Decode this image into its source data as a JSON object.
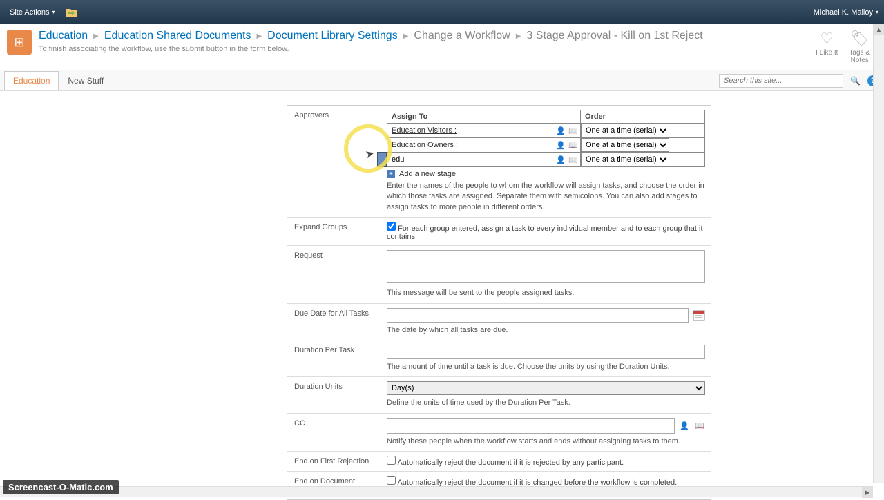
{
  "ribbon": {
    "site_actions": "Site Actions",
    "user": "Michael K. Malloy"
  },
  "breadcrumb": {
    "items": [
      "Education",
      "Education Shared Documents",
      "Document Library Settings",
      "Change a Workflow",
      "3 Stage Approval - Kill on 1st Reject"
    ],
    "subtitle": "To finish associating the workflow, use the submit button in the form below."
  },
  "header_actions": {
    "like": "I Like It",
    "tags": "Tags &\nNotes"
  },
  "tabs": {
    "active": "Education",
    "second": "New Stuff"
  },
  "search": {
    "placeholder": "Search this site..."
  },
  "form": {
    "approvers": {
      "label": "Approvers",
      "assign_header": "Assign To",
      "order_header": "Order",
      "rows": [
        {
          "value": "Education Visitors ;",
          "order": "One at a time (serial)"
        },
        {
          "value": "Education Owners ;",
          "order": "One at a time (serial)"
        },
        {
          "value": "edu",
          "order": "One at a time (serial)"
        }
      ],
      "add_stage": "Add a new stage",
      "help": "Enter the names of the people to whom the workflow will assign tasks, and choose the order in which those tasks are assigned. Separate them with semicolons. You can also add stages to assign tasks to more people in different orders."
    },
    "expand": {
      "label": "Expand Groups",
      "text": "For each group entered, assign a task to every individual member and to each group that it contains."
    },
    "request": {
      "label": "Request",
      "help": "This message will be sent to the people assigned tasks."
    },
    "due_date": {
      "label": "Due Date for All Tasks",
      "help": "The date by which all tasks are due."
    },
    "duration_task": {
      "label": "Duration Per Task",
      "help": "The amount of time until a task is due. Choose the units by using the Duration Units."
    },
    "duration_units": {
      "label": "Duration Units",
      "value": "Day(s)",
      "help": "Define the units of time used by the Duration Per Task."
    },
    "cc": {
      "label": "CC",
      "help": "Notify these people when the workflow starts and ends without assigning tasks to them."
    },
    "end_reject": {
      "label": "End on First Rejection",
      "text": "Automatically reject the document if it is rejected by any participant."
    },
    "end_change": {
      "label": "End on Document Change",
      "text": "Automatically reject the document if it is changed before the workflow is completed."
    }
  },
  "watermark": "Screencast-O-Matic.com"
}
